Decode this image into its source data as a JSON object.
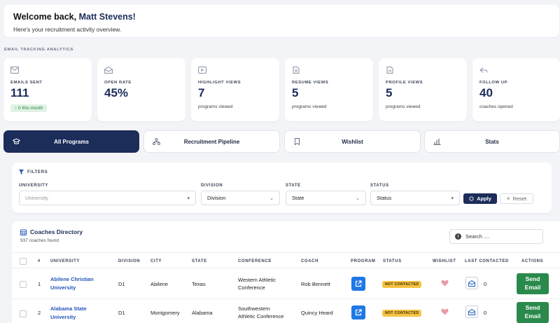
{
  "welcome": {
    "greeting": "Welcome back,",
    "name": "Matt Stevens!",
    "subtitle": "Here's your recruitment activity overview."
  },
  "analytics": {
    "section_label": "EMAIL TRACKING ANALYTICS",
    "cards": [
      {
        "icon": "envelope-icon",
        "label": "EMAILS SENT",
        "value": "111",
        "badge": "↑ 0 this month"
      },
      {
        "icon": "envelope-open-icon",
        "label": "OPEN RATE",
        "value": "45%"
      },
      {
        "icon": "video-icon",
        "label": "HIGHLIGHT VIEWS",
        "value": "7",
        "sub": "programs viewed"
      },
      {
        "icon": "document-icon",
        "label": "RESUME VIEWS",
        "value": "5",
        "sub": "programs viewed"
      },
      {
        "icon": "pdf-icon",
        "label": "PROFILE VIEWS",
        "value": "5",
        "sub": "programs viewed"
      },
      {
        "icon": "reply-icon",
        "label": "FOLLOW UP",
        "value": "40",
        "sub": "coaches opened"
      }
    ]
  },
  "tabs": [
    {
      "label": "All Programs",
      "icon": "graduation-cap-icon",
      "active": true
    },
    {
      "label": "Recruitment Pipeline",
      "icon": "pipeline-icon",
      "active": false
    },
    {
      "label": "Wishlist",
      "icon": "bookmark-icon",
      "active": false
    },
    {
      "label": "Stats",
      "icon": "bar-chart-icon",
      "active": false
    }
  ],
  "filters": {
    "title": "FILTERS",
    "university": {
      "label": "UNIVERSITY",
      "placeholder": "University"
    },
    "division": {
      "label": "DIVISION",
      "value": "Division"
    },
    "state": {
      "label": "STATE",
      "value": "State"
    },
    "status": {
      "label": "STATUS",
      "value": "Status"
    },
    "apply_label": "Apply",
    "reset_label": "Reset"
  },
  "directory": {
    "title": "Coaches Directory",
    "count": "937 coaches found",
    "search_placeholder": "Search ....",
    "columns": [
      "#",
      "UNIVERSITY",
      "DIVISION",
      "CITY",
      "STATE",
      "CONFERENCE",
      "COACH",
      "PROGRAM",
      "STATUS",
      "WISHLIST",
      "LAST CONTACTED",
      "ACTIONS"
    ],
    "rows": [
      {
        "num": "1",
        "university_1": "Abilene Christian",
        "university_2": "University",
        "division": "D1",
        "city": "Abilene",
        "state": "Texas",
        "conference_1": "Western Athletic",
        "conference_2": "Conference",
        "coach": "Rob Bennett",
        "status": "NOT CONTACTED",
        "last_contacted": "0",
        "action_1": "Send",
        "action_2": "Email"
      },
      {
        "num": "2",
        "university_1": "Alabama State",
        "university_2": "University",
        "division": "D1",
        "city": "Montgomery",
        "state": "Alabama",
        "conference_1": "Southwestern",
        "conference_2": "Athletic Conference",
        "coach": "Quincy Heard",
        "status": "NOT CONTACTED",
        "last_contacted": "0",
        "action_1": "Send",
        "action_2": "Email"
      }
    ]
  },
  "colors": {
    "navy": "#1c2d5a",
    "link": "#2456b8",
    "program": "#1e78e6",
    "status": "#f6c344",
    "send": "#2a8a4c",
    "heart": "#e99aa8"
  }
}
